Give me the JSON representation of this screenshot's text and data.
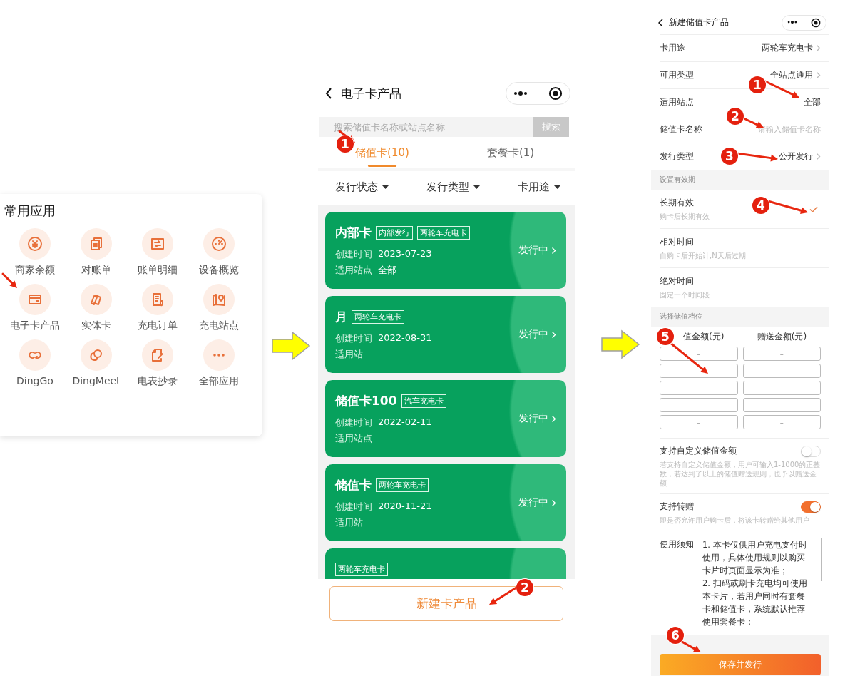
{
  "app_panel": {
    "title": "常用应用",
    "apps": [
      {
        "label": "商家余额",
        "pointer": false
      },
      {
        "label": "对账单",
        "pointer": false
      },
      {
        "label": "账单明细",
        "pointer": false
      },
      {
        "label": "设备概览",
        "pointer": false
      },
      {
        "label": "电子卡产品",
        "pointer": true
      },
      {
        "label": "实体卡",
        "pointer": false
      },
      {
        "label": "充电订单",
        "pointer": false
      },
      {
        "label": "充电站点",
        "pointer": false
      },
      {
        "label": "DingGo",
        "pointer": false
      },
      {
        "label": "DingMeet",
        "pointer": false
      },
      {
        "label": "电表抄录",
        "pointer": false
      },
      {
        "label": "全部应用",
        "pointer": false
      }
    ]
  },
  "card_list_screen": {
    "title": "电子卡产品",
    "search": {
      "placeholder": "搜索储值卡名称或站点名称",
      "button": "搜索"
    },
    "tabs": [
      {
        "label": "储值卡(10)",
        "selected": true,
        "marker": "1"
      },
      {
        "label": "套餐卡(1)",
        "selected": false
      }
    ],
    "filters": [
      "发行状态",
      "发行类型",
      "卡用途"
    ],
    "cards": [
      {
        "title": "内部卡",
        "tags": [
          "内部发行",
          "两轮车充电卡"
        ],
        "created_label": "创建时间",
        "created": "2023-07-23",
        "site_label": "适用站点",
        "site": "全部",
        "status": "发行中"
      },
      {
        "title": "月",
        "tags": [
          "两轮车充电卡"
        ],
        "created_label": "创建时间",
        "created": "2022-08-31",
        "site_label": "适用站",
        "status": "发行中"
      },
      {
        "title": "储值卡100",
        "tags": [
          "汽车充电卡"
        ],
        "created_label": "创建时间",
        "created": "2022-02-11",
        "site_label": "适用站点",
        "status": "发行中"
      },
      {
        "title": "储值卡",
        "tags": [
          "两轮车充电卡"
        ],
        "created_label": "创建时间",
        "created": "2020-11-21",
        "site_label": "适用站",
        "status": "发行中"
      },
      {
        "tags": [
          "两轮车充电卡"
        ]
      }
    ],
    "new_button": {
      "label": "新建卡产品",
      "marker": "2"
    }
  },
  "new_card_screen": {
    "title": "新建储值卡产品",
    "fields": [
      {
        "kind": "select",
        "label": "卡用途",
        "value": "两轮车充电卡"
      },
      {
        "kind": "select",
        "label": "可用类型",
        "value": "全站点通用"
      },
      {
        "kind": "text",
        "label": "适用站点",
        "value": "全部",
        "marker": "1"
      },
      {
        "kind": "input",
        "label": "储值卡名称",
        "placeholder": "请输入储值卡名称",
        "marker": "2"
      },
      {
        "kind": "select",
        "label": "发行类型",
        "value": "公开发行",
        "marker": "3"
      }
    ],
    "validity": {
      "heading": "设置有效期",
      "options": [
        {
          "title": "长期有效",
          "hint": "购卡后长期有效",
          "selected": true,
          "marker": "4"
        },
        {
          "title": "相对时间",
          "hint": "自购卡后开始计,N天后过期",
          "selected": false
        },
        {
          "title": "绝对时间",
          "hint": "固定一个时间段",
          "selected": false
        }
      ]
    },
    "tiers": {
      "heading": "选择储值档位",
      "columns": [
        "值金额(元)",
        "赠送金额(元)"
      ],
      "marker": "5",
      "rows": [
        {
          "amount": {
            "placeholder": "–"
          },
          "bonus": {
            "placeholder": "–"
          }
        },
        {
          "bonus": {
            "placeholder": "–"
          }
        },
        {
          "amount": {
            "placeholder": "–"
          },
          "bonus": {
            "placeholder": "–"
          }
        },
        {
          "amount": {
            "placeholder": "–"
          },
          "bonus": {
            "placeholder": "–"
          }
        },
        {
          "amount": {
            "placeholder": "–"
          },
          "bonus": {
            "placeholder": "–"
          }
        }
      ]
    },
    "switches": [
      {
        "title": "支持自定义储值金额",
        "hint": "若支持自定义储值金额，用户可输入1-1000的正整数，若达到了以上的储值赠送规则，也予以赠送金额",
        "on": false
      },
      {
        "title": "支持转赠",
        "hint": "即是否允许用户购卡后，将该卡转赠给其他用户",
        "on": true
      }
    ],
    "notice": {
      "label": "使用须知",
      "lines": [
        "1. 本卡仅供用户充电支付时使用，具体使用规则以购买卡片时页面显示为准；",
        "2. 扫码或刷卡充电均可使用本卡片，若用户同时有套餐卡和储值卡，系统默认推荐使用套餐卡；"
      ]
    },
    "save_button": {
      "label": "保存并发行",
      "marker": "6"
    }
  }
}
